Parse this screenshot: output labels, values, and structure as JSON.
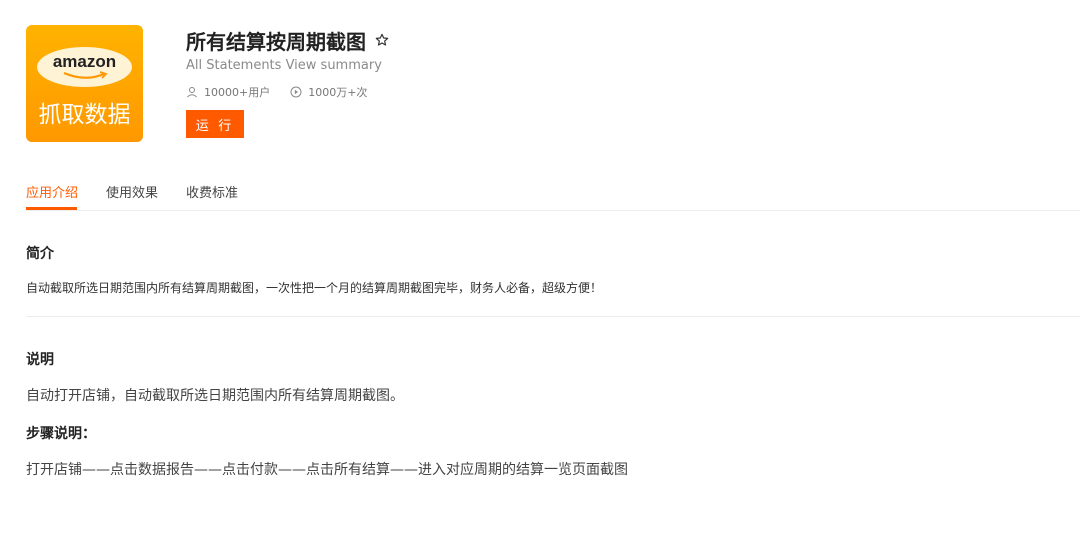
{
  "app": {
    "logo_brand": "amazon",
    "logo_caption": "抓取数据",
    "title": "所有结算按周期截图",
    "subtitle": "All Statements View summary",
    "users_stat": "10000+用户",
    "runs_stat": "1000万+次",
    "run_label": "运 行"
  },
  "tabs": [
    {
      "label": "应用介绍",
      "active": true
    },
    {
      "label": "使用效果",
      "active": false
    },
    {
      "label": "收费标准",
      "active": false
    }
  ],
  "intro": {
    "heading": "简介",
    "text": "自动截取所选日期范围内所有结算周期截图，一次性把一个月的结算周期截图完毕，财务人必备，超级方便！"
  },
  "description": {
    "heading": "说明",
    "text": "自动打开店铺，自动截取所选日期范围内所有结算周期截图。",
    "steps_heading": "步骤说明：",
    "steps_text": "打开店铺——点击数据报告——点击付款——点击所有结算——进入对应周期的结算一览页面截图"
  },
  "colors": {
    "accent": "#ff5a00",
    "logo_bg": "#ffa000"
  },
  "icons": {
    "favorite": "star-outline-icon",
    "users": "user-icon",
    "runs": "play-circle-icon"
  }
}
